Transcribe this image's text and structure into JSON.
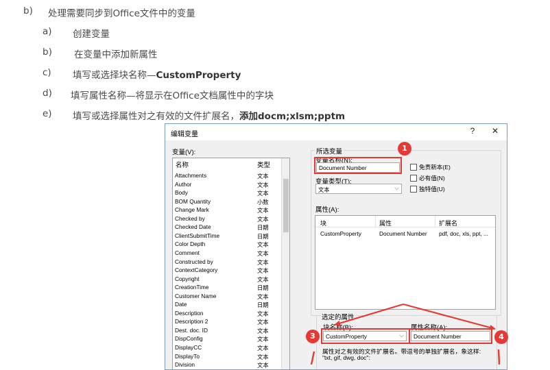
{
  "instructions": {
    "b": {
      "marker": "b)",
      "text": "处理需要同步到Office文件中的变量"
    },
    "items": [
      {
        "marker": "a)",
        "text": "创建变量",
        "bold": ""
      },
      {
        "marker": "b)",
        "text": "在变量中添加新属性",
        "bold": ""
      },
      {
        "marker": "c)",
        "text": "填写或选择块名称—",
        "bold": "CustomProperty"
      },
      {
        "marker": "d)",
        "text": "填写属性名称—将显示在Office文档属性中的字块",
        "bold": ""
      },
      {
        "marker": "e)",
        "text": "填写或选择属性对之有效的文件扩展名，",
        "bold": "添加docm;xlsm;pptm"
      }
    ]
  },
  "dialog": {
    "title": "编辑变量",
    "help_button": "?",
    "close_button": "✕",
    "variables_label": "变量(V):",
    "list_header_name": "名称",
    "list_header_type": "类型",
    "variables": [
      {
        "name": "Attachments",
        "type": "文本"
      },
      {
        "name": "Author",
        "type": "文本"
      },
      {
        "name": "Body",
        "type": "文本"
      },
      {
        "name": "BOM Quantity",
        "type": "小数"
      },
      {
        "name": "Change Mark",
        "type": "文本"
      },
      {
        "name": "Checked by",
        "type": "文本"
      },
      {
        "name": "Checked Date",
        "type": "日期"
      },
      {
        "name": "ClientSubmitTime",
        "type": "日期"
      },
      {
        "name": "Color Depth",
        "type": "文本"
      },
      {
        "name": "Comment",
        "type": "文本"
      },
      {
        "name": "Constructed by",
        "type": "文本"
      },
      {
        "name": "ContextCategory",
        "type": "文本"
      },
      {
        "name": "Copyright",
        "type": "文本"
      },
      {
        "name": "CreationTime",
        "type": "日期"
      },
      {
        "name": "Customer Name",
        "type": "文本"
      },
      {
        "name": "Date",
        "type": "日期"
      },
      {
        "name": "Description",
        "type": "文本"
      },
      {
        "name": "Description 2",
        "type": "文本"
      },
      {
        "name": "Dest. doc. ID",
        "type": "文本"
      },
      {
        "name": "DispConfig",
        "type": "文本"
      },
      {
        "name": "DisplayCC",
        "type": "文本"
      },
      {
        "name": "DisplayTo",
        "type": "文本"
      },
      {
        "name": "Division",
        "type": "文本"
      }
    ],
    "selected_variable_label": "所选变量",
    "variable_name_label": "变量名称(N):",
    "variable_name_value": "Document Number",
    "no_revision_label": "免责新本(E)",
    "required_label": "必有值(N)",
    "unique_label": "独特值(U)",
    "variable_type_label": "变量类型(T):",
    "variable_type_value": "文本",
    "properties_label": "属性(A):",
    "prop_headers": [
      "块",
      "属性",
      "扩展名"
    ],
    "prop_rows": [
      {
        "block": "CustomProperty",
        "property": "Document Number",
        "ext": "pdf, doc, xls, ppt, ..."
      }
    ],
    "selected_property_label": "选定的属性",
    "block_name_label": "块名称(B):",
    "block_name_value": "CustomProperty",
    "prop_name_label": "属性名称(A):",
    "prop_name_value": "Document Number",
    "ext_help_line1": "属性对之有效的文件扩展名。带逗号的单独扩展名，象这样:",
    "ext_help_line2": "\"txt, gif, dwg, doc\":"
  },
  "callouts": [
    "1",
    "3",
    "4"
  ],
  "colors": {
    "highlight": "#e53935"
  }
}
